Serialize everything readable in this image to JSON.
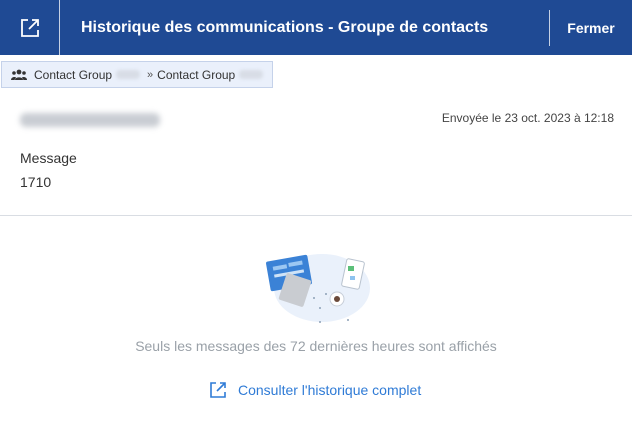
{
  "header": {
    "title": "Historique des communications - Groupe de contacts",
    "close_label": "Fermer",
    "icon": "external-link-icon"
  },
  "breadcrumb": {
    "icon": "group-icon",
    "items": [
      {
        "label": "Contact Group"
      },
      {
        "label": "Contact Group"
      }
    ],
    "separator": "»"
  },
  "message": {
    "sent_at": "Envoyée le 23 oct. 2023 à 12:18",
    "label": "Message",
    "value": "1710"
  },
  "empty_state": {
    "info": "Seuls les messages des 72 dernières heures sont affichés",
    "link_label": "Consulter l'historique complet",
    "link_icon": "external-link-icon"
  },
  "colors": {
    "header_bg": "#1f4a94",
    "link": "#2f7bd6",
    "muted_text": "#9aa1a8"
  }
}
